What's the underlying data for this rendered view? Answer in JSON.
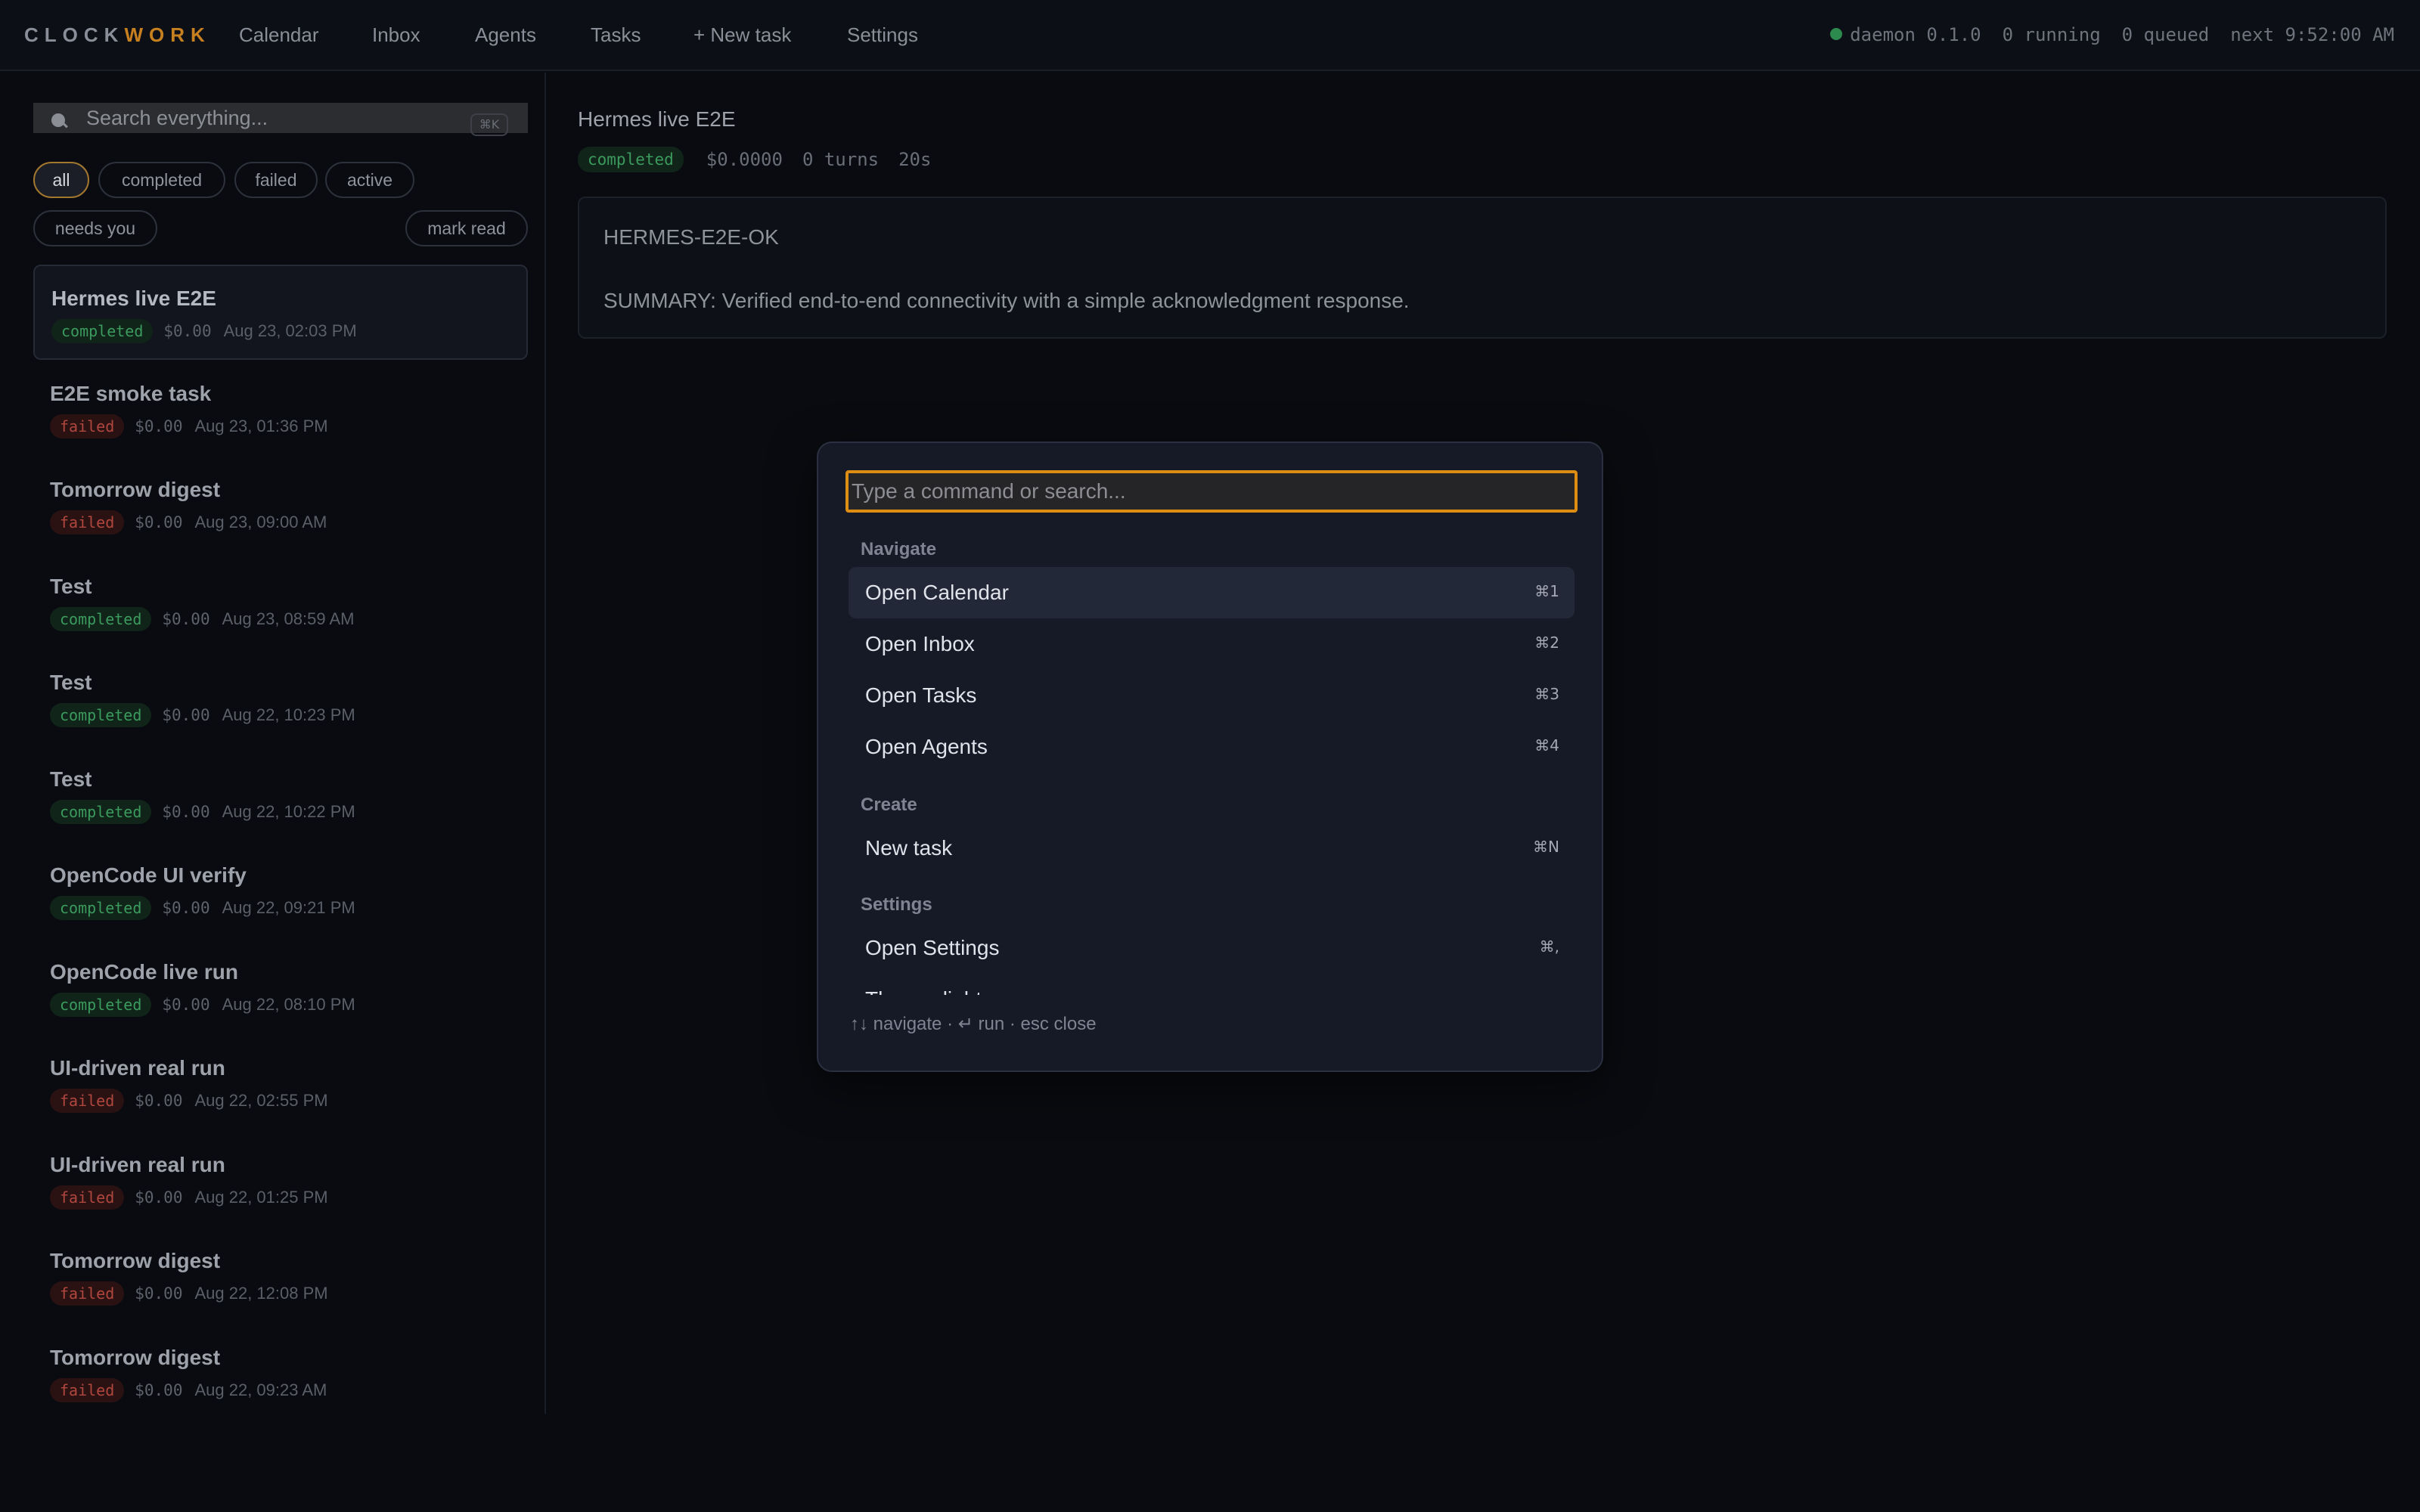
{
  "brand": {
    "part1": "CLOCK",
    "part2": "WORK"
  },
  "nav": [
    {
      "label": "Calendar"
    },
    {
      "label": "Inbox"
    },
    {
      "label": "Agents"
    },
    {
      "label": "Tasks"
    },
    {
      "label": "+ New task"
    },
    {
      "label": "Settings"
    }
  ],
  "status": {
    "daemon": "daemon 0.1.0",
    "running": "0 running",
    "queued": "0 queued",
    "next": "next 9:52:00 AM",
    "color": "#2d8a4f"
  },
  "sidebar": {
    "search": {
      "placeholder": "Search everything...",
      "shortcut": "⌘K"
    },
    "filters": [
      "all",
      "completed",
      "failed",
      "active",
      "needs you"
    ],
    "active_filter": "all",
    "mark_read": "mark read",
    "items": [
      {
        "title": "Hermes live E2E",
        "status": "completed",
        "cost": "$0.00",
        "date": "Aug 23, 02:03 PM"
      },
      {
        "title": "E2E smoke task",
        "status": "failed",
        "cost": "$0.00",
        "date": "Aug 23, 01:36 PM"
      },
      {
        "title": "Tomorrow digest",
        "status": "failed",
        "cost": "$0.00",
        "date": "Aug 23, 09:00 AM"
      },
      {
        "title": "Test",
        "status": "completed",
        "cost": "$0.00",
        "date": "Aug 23, 08:59 AM"
      },
      {
        "title": "Test",
        "status": "completed",
        "cost": "$0.00",
        "date": "Aug 22, 10:23 PM"
      },
      {
        "title": "Test",
        "status": "completed",
        "cost": "$0.00",
        "date": "Aug 22, 10:22 PM"
      },
      {
        "title": "OpenCode UI verify",
        "status": "completed",
        "cost": "$0.00",
        "date": "Aug 22, 09:21 PM"
      },
      {
        "title": "OpenCode live run",
        "status": "completed",
        "cost": "$0.00",
        "date": "Aug 22, 08:10 PM"
      },
      {
        "title": "UI-driven real run",
        "status": "failed",
        "cost": "$0.00",
        "date": "Aug 22, 02:55 PM"
      },
      {
        "title": "UI-driven real run",
        "status": "failed",
        "cost": "$0.00",
        "date": "Aug 22, 01:25 PM"
      },
      {
        "title": "Tomorrow digest",
        "status": "failed",
        "cost": "$0.00",
        "date": "Aug 22, 12:08 PM"
      },
      {
        "title": "Tomorrow digest",
        "status": "failed",
        "cost": "$0.00",
        "date": "Aug 22, 09:23 AM"
      }
    ]
  },
  "detail": {
    "title": "Hermes live E2E",
    "status": "completed",
    "cost": "$0.0000",
    "turns": "0 turns",
    "duration": "20s",
    "output_line1": "HERMES-E2E-OK",
    "output_line2": "SUMMARY: Verified end-to-end connectivity with a simple acknowledgment response."
  },
  "palette": {
    "placeholder": "Type a command or search...",
    "groups": [
      {
        "label": "Navigate",
        "items": [
          {
            "label": "Open Calendar",
            "shortcut": "⌘1"
          },
          {
            "label": "Open Inbox",
            "shortcut": "⌘2"
          },
          {
            "label": "Open Tasks",
            "shortcut": "⌘3"
          },
          {
            "label": "Open Agents",
            "shortcut": "⌘4"
          }
        ]
      },
      {
        "label": "Create",
        "items": [
          {
            "label": "New task",
            "shortcut": "⌘N"
          }
        ]
      },
      {
        "label": "Settings",
        "items": [
          {
            "label": "Open Settings",
            "shortcut": "⌘,"
          },
          {
            "label": "Theme: light",
            "shortcut": ""
          }
        ]
      }
    ],
    "footer": "↑↓ navigate · ↵ run · esc close"
  },
  "colors": {
    "accent": "#dd8e12",
    "brand_accent": "#c7801f",
    "completed": "#3b9a5d",
    "failed": "#b0473f",
    "background": "#090b10"
  }
}
